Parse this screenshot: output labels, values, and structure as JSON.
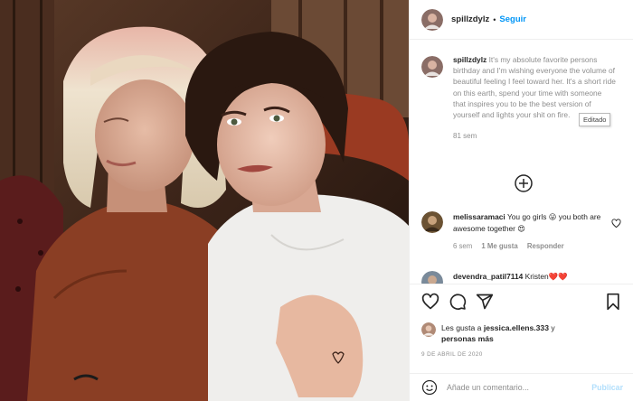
{
  "header": {
    "username": "spillzdylz",
    "separator": "•",
    "follow_label": "Seguir"
  },
  "caption": {
    "username": "spillzdylz",
    "text": "It's my absolute favorite persons birthday and I'm wishing everyone the volume of beautiful feeling I feel toward her. It's a short ride on this earth, spend your time with someone that inspires you to be the best version of yourself and lights your shit on fire.",
    "time": "81 sem",
    "tooltip": "Editado"
  },
  "comments": [
    {
      "username": "melissaramaci",
      "text": "You go girls 😛 you both are awesome together 😍",
      "time": "6 sem",
      "likes": "1 Me gusta",
      "reply_label": "Responder"
    },
    {
      "username": "devendra_patil7114",
      "text": "Kristen❤️❤️",
      "time": "",
      "likes": "",
      "reply_label": ""
    }
  ],
  "actions": {
    "icons": [
      "heart-icon",
      "comment-icon",
      "share-icon",
      "bookmark-icon"
    ]
  },
  "likes": {
    "prefix": "Les gusta a",
    "user": "jessica.ellens.333",
    "suffix": "y",
    "others": "personas más"
  },
  "date": "9 DE ABRIL DE 2020",
  "add_comment": {
    "placeholder": "Añade un comentario...",
    "publish_label": "Publicar"
  },
  "colors": {
    "link_blue": "#0095f6",
    "publish_disabled": "#b2dffc",
    "muted_text": "#8e8e8e",
    "border": "#efefef",
    "heart_red": "#ed4956"
  }
}
